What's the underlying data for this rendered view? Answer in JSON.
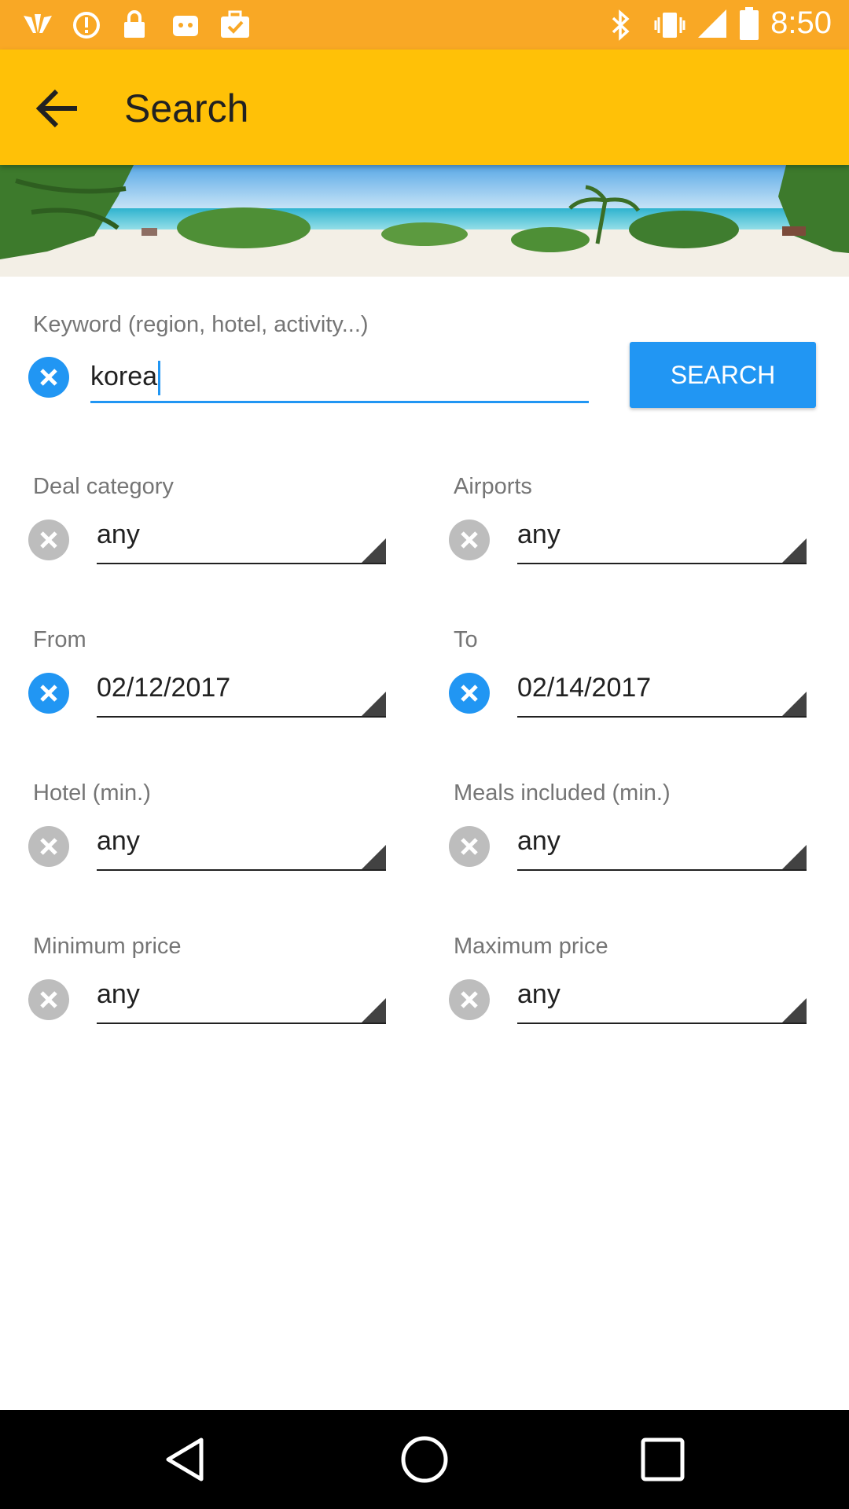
{
  "status_bar": {
    "time": "8:50",
    "icons": [
      "whale-tail-icon",
      "alert-circle-icon",
      "lock-icon",
      "android-icon",
      "briefcase-check-icon",
      "bluetooth-icon",
      "vibrate-icon",
      "signal-icon",
      "battery-icon"
    ]
  },
  "app_bar": {
    "title": "Search",
    "back_icon": "arrow-back-icon"
  },
  "banner": {
    "image": "beach-banner"
  },
  "keyword": {
    "label": "Keyword (region, hotel, activity...)",
    "value": "korea"
  },
  "search_button": "SEARCH",
  "filters": [
    {
      "label": "Deal category",
      "value": "any",
      "active": false
    },
    {
      "label": "Airports",
      "value": "any",
      "active": false
    },
    {
      "label": "From",
      "value": "02/12/2017",
      "active": true
    },
    {
      "label": "To",
      "value": "02/14/2017",
      "active": true
    },
    {
      "label": "Hotel (min.)",
      "value": "any",
      "active": false
    },
    {
      "label": "Meals included (min.)",
      "value": "any",
      "active": false
    },
    {
      "label": "Minimum price",
      "value": "any",
      "active": false
    },
    {
      "label": "Maximum price",
      "value": "any",
      "active": false
    }
  ],
  "colors": {
    "status_bar": "#f9a825",
    "app_bar": "#ffc107",
    "accent": "#2196f3",
    "inactive_clear": "#bdbdbd"
  },
  "nav_bar": {
    "icons": [
      "back-triangle-icon",
      "home-circle-icon",
      "recents-square-icon"
    ]
  }
}
